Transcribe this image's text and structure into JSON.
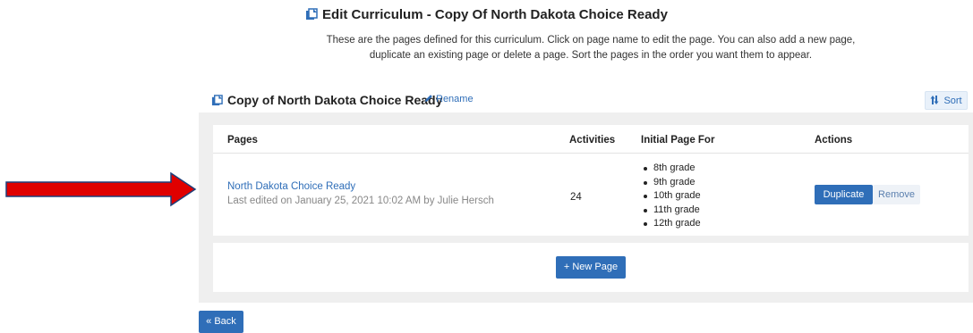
{
  "header": {
    "title": "Edit Curriculum - Copy Of North Dakota Choice Ready",
    "intro_line1": "These are the pages defined for this curriculum. Click on page name to edit the page. You can also add a new page,",
    "intro_line2": "duplicate an existing page or delete a page. Sort the pages in the order you want them to appear.",
    "icon": "copy-icon"
  },
  "panel": {
    "title": "Copy of North Dakota Choice Ready",
    "rename_label": "Rename",
    "sort_label": "Sort",
    "title_icon": "copy-icon",
    "rename_icon": "pencil-icon",
    "sort_icon": "sort-icon"
  },
  "table": {
    "columns": [
      "Pages",
      "Activities",
      "Initial Page For",
      "Actions"
    ],
    "rows": [
      {
        "page_name": "North Dakota Choice Ready",
        "last_edited": "Last edited on January 25, 2021 10:02 AM by Julie Hersch",
        "activities": "24",
        "initial_page_for": [
          "8th grade",
          "9th grade",
          "10th grade",
          "11th grade",
          "12th grade"
        ],
        "duplicate_label": "Duplicate",
        "remove_label": "Remove"
      }
    ]
  },
  "new_page_label": "+ New Page",
  "back_label": "« Back",
  "colors": {
    "primary": "#2f6eb8",
    "panel_bg": "#efefef",
    "arrow_red": "#e00000",
    "arrow_outline": "#1f3f7a"
  }
}
